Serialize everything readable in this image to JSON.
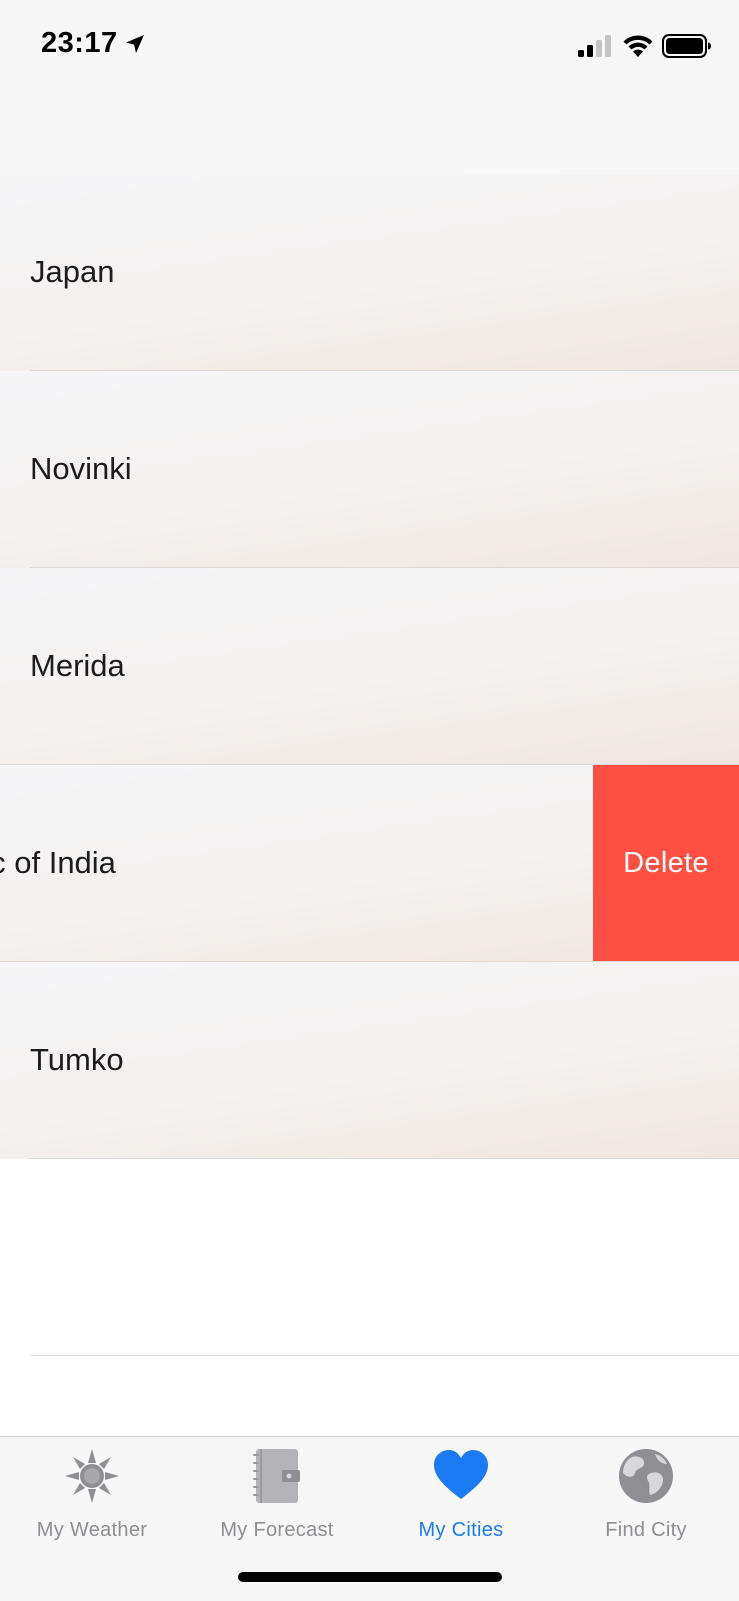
{
  "status_bar": {
    "time": "23:17"
  },
  "cities": [
    {
      "label": "Japan",
      "swiped": false
    },
    {
      "label": "Novinki",
      "swiped": false
    },
    {
      "label": "Merida",
      "swiped": false
    },
    {
      "label": "Republic of India",
      "swiped": true
    },
    {
      "label": "Tumko",
      "swiped": false
    }
  ],
  "swipe_action": {
    "label": "Delete",
    "color": "#fe4f43"
  },
  "tab_bar": {
    "tabs": [
      {
        "label": "My Weather",
        "icon": "sun-icon",
        "active": false
      },
      {
        "label": "My Forecast",
        "icon": "notebook-icon",
        "active": false
      },
      {
        "label": "My Cities",
        "icon": "heart-icon",
        "active": true
      },
      {
        "label": "Find City",
        "icon": "globe-icon",
        "active": false
      }
    ],
    "active_color": "#1a7bf5",
    "inactive_color": "#8e8e93"
  }
}
